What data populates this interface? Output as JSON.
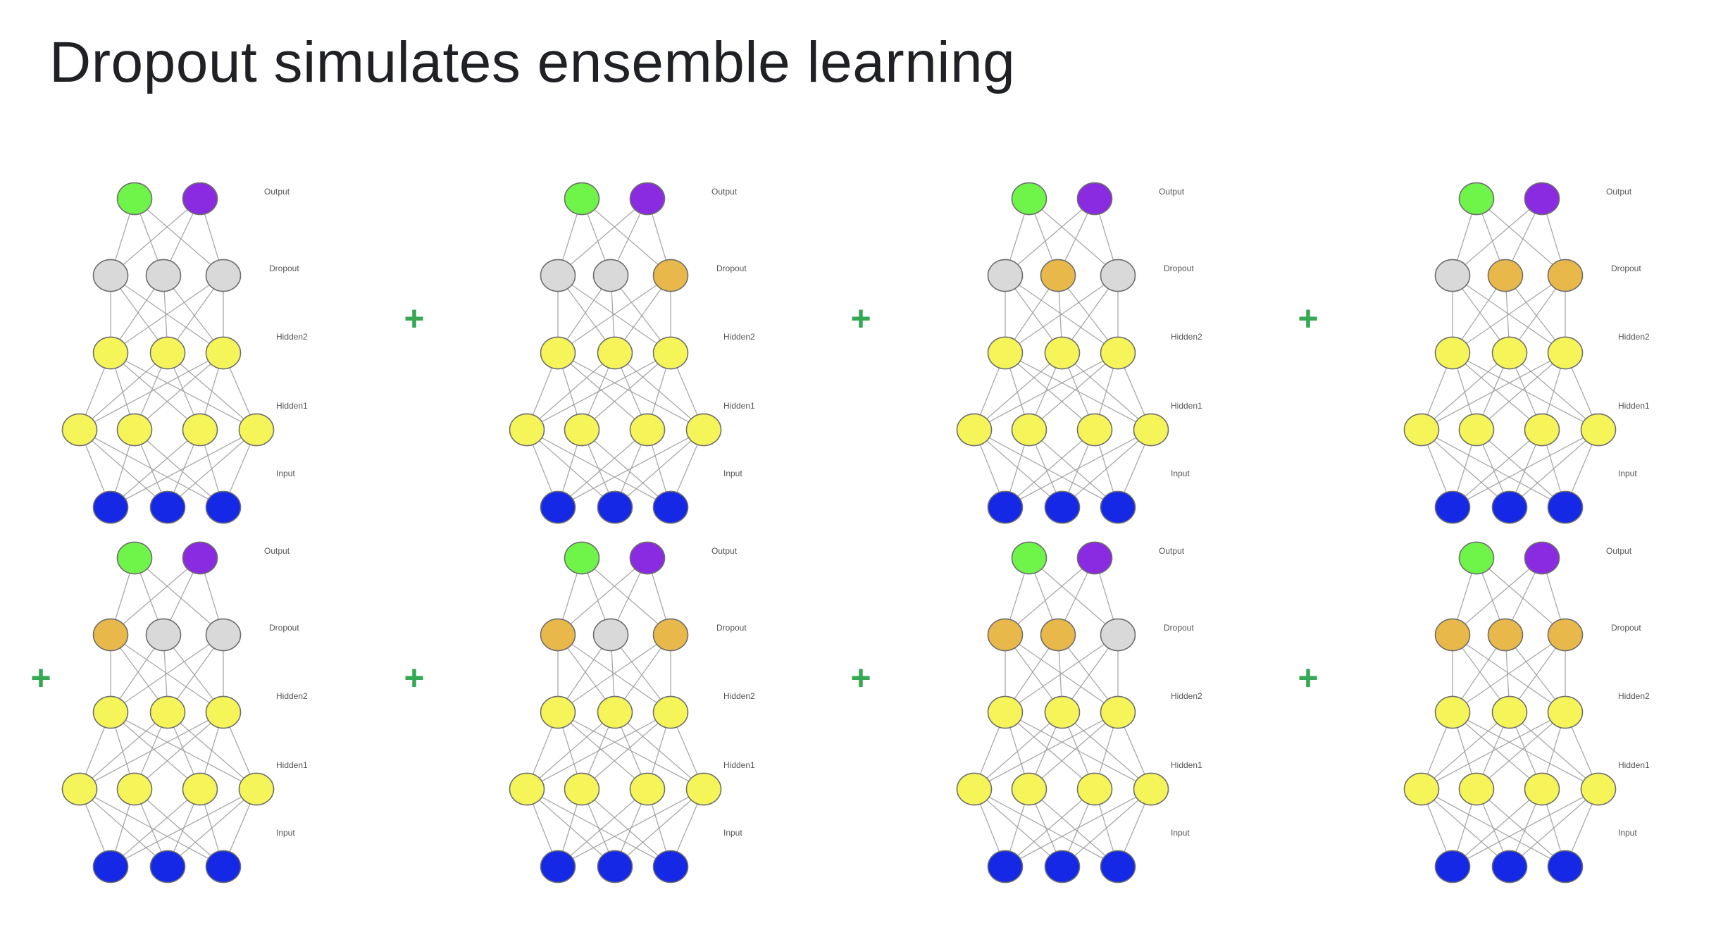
{
  "slide": {
    "title": "Dropout simulates ensemble learning"
  },
  "layer_labels": [
    "Output",
    "Dropout",
    "Hidden2",
    "Hidden1",
    "Input"
  ],
  "plus_symbol": "+",
  "colors": {
    "output_a": "#6ff54a",
    "output_b": "#8a2be2",
    "dropout_inactive": "#d9d9d9",
    "dropout_active": "#e8b84a",
    "hidden": "#f5f55a",
    "input": "#1428e6",
    "plus": "#34a853"
  },
  "networks": [
    {
      "dropout_active": [
        false,
        false,
        false
      ]
    },
    {
      "dropout_active": [
        false,
        false,
        true
      ]
    },
    {
      "dropout_active": [
        false,
        true,
        false
      ]
    },
    {
      "dropout_active": [
        false,
        true,
        true
      ]
    },
    {
      "dropout_active": [
        true,
        false,
        false
      ]
    },
    {
      "dropout_active": [
        true,
        false,
        true
      ]
    },
    {
      "dropout_active": [
        true,
        true,
        false
      ]
    },
    {
      "dropout_active": [
        true,
        true,
        true
      ]
    }
  ]
}
